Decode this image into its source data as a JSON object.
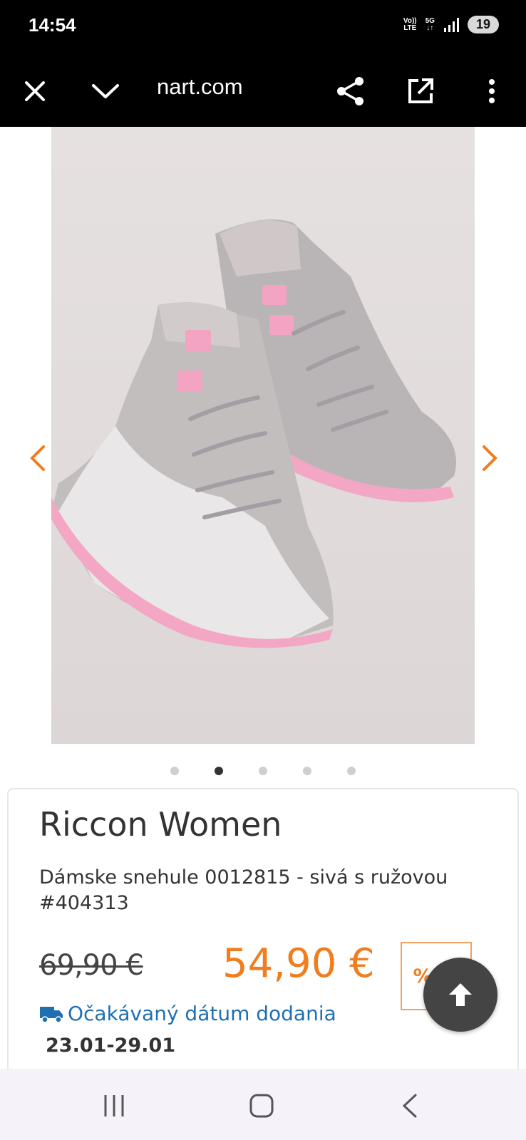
{
  "status_bar": {
    "time": "14:54",
    "volte_top": "Vo))",
    "volte_bottom": "LTE",
    "network_top": "5G",
    "network_bottom": "↓↑",
    "battery": "19"
  },
  "toolbar": {
    "url": "nart.com",
    "icons": [
      "close-icon",
      "chevron-down-icon",
      "share-icon",
      "open-external-icon",
      "more-vert-icon"
    ]
  },
  "gallery": {
    "image_count": 5,
    "active_index": 1
  },
  "product": {
    "brand": "Riccon Women",
    "title": "Dámske snehule 0012815 - sivá s ružovou #404313",
    "old_price": "69,90 €",
    "new_price": "54,90 €",
    "discount": "%21",
    "delivery_label": "Očakávaný dátum dodania",
    "delivery_date": "23.01-29.01"
  },
  "colors": {
    "accent_orange": "#f07d1e",
    "link_blue": "#1f6fb3"
  }
}
